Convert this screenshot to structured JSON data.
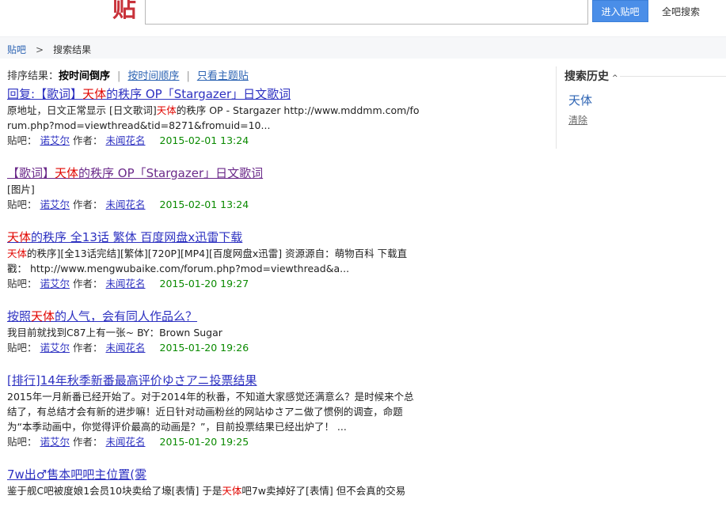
{
  "header": {
    "logo_text": "贴",
    "search_value": "",
    "enter_button": "进入贴吧",
    "all_search": "全吧搜索"
  },
  "breadcrumb": {
    "home": "贴吧",
    "separator": ">",
    "current": "搜索结果"
  },
  "sort": {
    "label": "排序结果：",
    "current": "按时间倒序",
    "option_time_asc": "按时间顺序",
    "option_topics": "只看主题贴"
  },
  "sidebar": {
    "title": "搜索历史",
    "caret": "^",
    "history_item": "天体",
    "clear": "清除"
  },
  "meta_labels": {
    "forum": "贴吧：",
    "author": "作者："
  },
  "results": [
    {
      "title_pre": "回复:【歌词】",
      "title_hl": "天体",
      "title_post": "的秩序 OP「Stargazer」日文歌词",
      "desc_pre": "原地址，日文正常显示 [日文歌词]",
      "desc_hl": "天体",
      "desc_post": "的秩序 OP - Stargazer http://www.mddmm.com/forum.php?mod=viewthread&tid=8271&fromuid=10...",
      "forum": "诺艾尔",
      "author": "未闻花名",
      "date": "2015-02-01 13:24"
    },
    {
      "title_pre": "【歌词】",
      "title_hl": "天体",
      "title_post": "的秩序 OP「Stargazer」日文歌词",
      "desc_pre": "[图片]",
      "desc_hl": "",
      "desc_post": "",
      "forum": "诺艾尔",
      "author": "未闻花名",
      "date": "2015-02-01 13:24"
    },
    {
      "title_pre": "",
      "title_hl": "天体",
      "title_post": "的秩序 全13话 繁体 百度网盘x迅雷下载",
      "desc_pre": "",
      "desc_hl": "天体",
      "desc_post": "的秩序][全13话完结][繁体][720P][MP4][百度网盘x迅雷] 资源源自：萌物百科 下载直戳： http://www.mengwubaike.com/forum.php?mod=viewthread&a...",
      "forum": "诺艾尔",
      "author": "未闻花名",
      "date": "2015-01-20 19:27"
    },
    {
      "title_pre": "按照",
      "title_hl": "天体",
      "title_post": "的人气，会有同人作品么？",
      "desc_pre": "我目前就找到C87上有一张~ BY：Brown Sugar",
      "desc_hl": "",
      "desc_post": "",
      "forum": "诺艾尔",
      "author": "未闻花名",
      "date": "2015-01-20 19:26"
    },
    {
      "title_pre": "[排行]14年秋季新番最高评价ゆさアニ投票结果",
      "title_hl": "",
      "title_post": "",
      "desc_pre": "2015年一月新番已经开始了。对于2014年的秋番，不知道大家感觉还满意么？是时候来个总结了，有总结才会有新的进步嘛！近日针对动画粉丝的网站ゆさアニ做了惯例的调查，命题为“本季动画中，你觉得评价最高的动画是？”，目前投票结果已经出炉了！ ...",
      "desc_hl": "",
      "desc_post": "",
      "forum": "诺艾尔",
      "author": "未闻花名",
      "date": "2015-01-20 19:25"
    },
    {
      "title_pre": "7w出♂售本吧吧主位置(雾",
      "title_hl": "",
      "title_post": "",
      "desc_pre": "鉴于舰C吧被度娘1会员10块卖给了壕[表情] 于是",
      "desc_hl": "天体",
      "desc_post": "吧7w卖掉好了[表情] 但不会真的交易",
      "forum": "",
      "author": "",
      "date": ""
    }
  ]
}
